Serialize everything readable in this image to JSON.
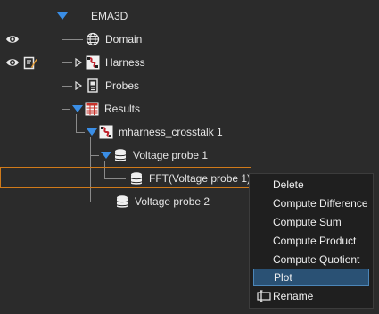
{
  "tree": {
    "root": {
      "label": "EMA3D"
    },
    "items": [
      {
        "label": "Domain"
      },
      {
        "label": "Harness"
      },
      {
        "label": "Probes"
      },
      {
        "label": "Results"
      },
      {
        "label": "mharness_crosstalk 1"
      },
      {
        "label": "Voltage probe 1"
      },
      {
        "label": "FFT(Voltage probe 1)"
      },
      {
        "label": "Voltage probe 2"
      }
    ]
  },
  "context_menu": {
    "items": [
      {
        "label": "Delete"
      },
      {
        "label": "Compute Difference"
      },
      {
        "label": "Compute Sum"
      },
      {
        "label": "Compute Product"
      },
      {
        "label": "Compute Quotient"
      },
      {
        "label": "Plot"
      },
      {
        "label": "Rename"
      }
    ],
    "highlighted": "Plot"
  },
  "colors": {
    "background": "#2b2b2b",
    "selection_border": "#d07a1a",
    "accent_blue": "#3a8ee6",
    "menu_highlight": "#2a5174"
  }
}
